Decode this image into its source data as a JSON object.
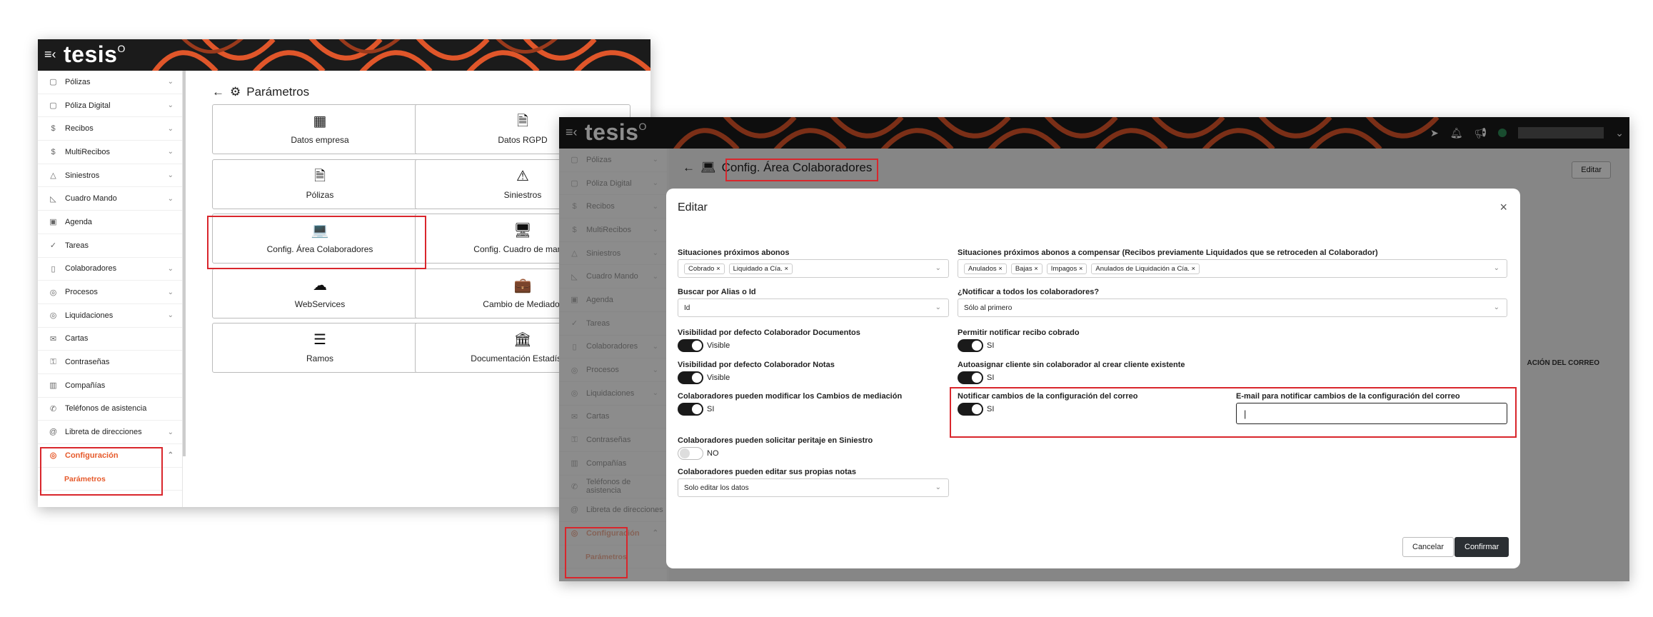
{
  "app": {
    "logo": "tesis",
    "logo_mark": "O",
    "menu_icon": "hamburger-collapse-icon"
  },
  "sidebar": {
    "items": [
      {
        "label": "Pólizas",
        "icon": "document-icon",
        "glyph": "▢",
        "chevron": true
      },
      {
        "label": "Póliza Digital",
        "icon": "tablet-icon",
        "glyph": "▢",
        "chevron": true
      },
      {
        "label": "Recibos",
        "icon": "dollar-icon",
        "glyph": "$",
        "chevron": true
      },
      {
        "label": "MultiRecibos",
        "icon": "dollar-icon",
        "glyph": "$",
        "chevron": true
      },
      {
        "label": "Siniestros",
        "icon": "warning-icon",
        "glyph": "△",
        "chevron": true
      },
      {
        "label": "Cuadro Mando",
        "icon": "chart-icon",
        "glyph": "◺",
        "chevron": true
      },
      {
        "label": "Agenda",
        "icon": "calendar-icon",
        "glyph": "▣",
        "chevron": false
      },
      {
        "label": "Tareas",
        "icon": "check-icon",
        "glyph": "✓",
        "chevron": false
      },
      {
        "label": "Colaboradores",
        "icon": "person-icon",
        "glyph": "▯",
        "chevron": true
      },
      {
        "label": "Procesos",
        "icon": "process-icon",
        "glyph": "◎",
        "chevron": true
      },
      {
        "label": "Liquidaciones",
        "icon": "settle-icon",
        "glyph": "◎",
        "chevron": true
      },
      {
        "label": "Cartas",
        "icon": "mail-icon",
        "glyph": "✉",
        "chevron": false
      },
      {
        "label": "Contraseñas",
        "icon": "lock-icon",
        "glyph": "⚿",
        "chevron": false
      },
      {
        "label": "Compañías",
        "icon": "building-icon",
        "glyph": "▥",
        "chevron": false
      },
      {
        "label": "Teléfonos de asistencia",
        "icon": "phone-icon",
        "glyph": "✆",
        "chevron": false
      },
      {
        "label": "Libreta de direcciones",
        "icon": "at-icon",
        "glyph": "@",
        "chevron": true
      }
    ],
    "config": {
      "label": "Configuración",
      "icon": "config-icon",
      "glyph": "◎"
    },
    "config_sub": {
      "label": "Parámetros"
    }
  },
  "params_page": {
    "title": "Parámetros",
    "cards": [
      {
        "label": "Datos empresa",
        "glyph": "▦"
      },
      {
        "label": "Datos RGPD",
        "glyph": "🗎"
      },
      {
        "label": "Pólizas",
        "glyph": "🗎"
      },
      {
        "label": "Siniestros",
        "glyph": "⚠"
      },
      {
        "label": "Config. Área Colaboradores",
        "glyph": "💻"
      },
      {
        "label": "Config. Cuadro de mando",
        "glyph": "🖥"
      },
      {
        "label": "WebServices",
        "glyph": "☁"
      },
      {
        "label": "Cambio de Mediador",
        "glyph": "💼"
      },
      {
        "label": "Ramos",
        "glyph": "☰"
      },
      {
        "label": "Documentación Estadística",
        "glyph": "🏛"
      }
    ]
  },
  "colab_page": {
    "title": "Config. Área Colaboradores",
    "edit_label": "Editar",
    "bg_text": "ACIÓN DEL CORREO"
  },
  "topbar_icons": [
    "send-icon",
    "bell-icon",
    "megaphone-icon",
    "avatar"
  ],
  "modal": {
    "title": "Editar",
    "close": "×",
    "sit_prox_abonos": {
      "label": "Situaciones próximos abonos",
      "chips": [
        "Cobrado ×",
        "Liquidado a Cía. ×"
      ]
    },
    "sit_prox_compensar": {
      "label": "Situaciones próximos abonos a compensar (Recibos previamente Liquidados que se retroceden al Colaborador)",
      "chips": [
        "Anulados ×",
        "Bajas ×",
        "Impagos ×",
        "Anulados de Liquidación a Cía. ×"
      ]
    },
    "buscar": {
      "label": "Buscar por Alias o Id",
      "value": "Id"
    },
    "notificar_todos": {
      "label": "¿Notificar a todos los colaboradores?",
      "value": "Sólo al primero"
    },
    "vis_doc": {
      "label": "Visibilidad por defecto Colaborador Documentos",
      "value": "Visible",
      "on": true
    },
    "permitir_notif": {
      "label": "Permitir notificar recibo cobrado",
      "value": "SI",
      "on": true
    },
    "vis_notas": {
      "label": "Visibilidad por defecto Colaborador Notas",
      "value": "Visible",
      "on": true
    },
    "autoasignar": {
      "label": "Autoasignar cliente sin colaborador al crear cliente existente",
      "value": "SI",
      "on": true
    },
    "mod_mediacion": {
      "label": "Colaboradores pueden modificar los Cambios de mediación",
      "value": "SI",
      "on": true
    },
    "notif_cambios": {
      "label": "Notificar cambios de la configuración del correo",
      "value": "SI",
      "on": true
    },
    "email_notif": {
      "label": "E-mail para notificar cambios de la configuración del correo",
      "value": "|"
    },
    "peritaje": {
      "label": "Colaboradores pueden solicitar peritaje en Siniestro",
      "value": "NO",
      "on": false
    },
    "editar_notas": {
      "label": "Colaboradores pueden editar sus propias notas",
      "value": "Solo editar los datos"
    },
    "cancel_label": "Cancelar",
    "confirm_label": "Confirmar"
  }
}
